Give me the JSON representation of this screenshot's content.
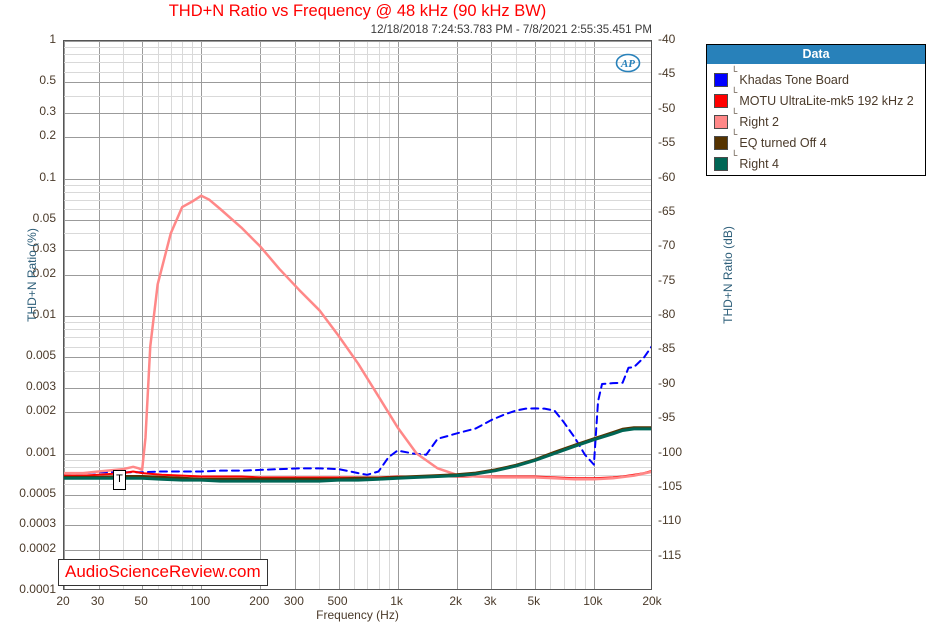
{
  "chart_data": {
    "type": "line",
    "title": "THD+N Ratio vs Frequency @ 48 kHz (90 kHz BW)",
    "subtitle": "12/18/2018 7:24:53.783 PM - 7/8/2021 2:55:35.451 PM",
    "xlabel": "Frequency (Hz)",
    "ylabel": "THD+N Ratio (%)",
    "ylabel_right": "THD+N Ratio (dB)",
    "xscale": "log",
    "yscale": "log",
    "xlim": [
      20,
      20000
    ],
    "ylim": [
      0.0001,
      1
    ],
    "ylim_right": [
      -120,
      -40
    ],
    "grid": true,
    "legend_position": "outside-right",
    "legend_title": "Data",
    "xticks": [
      "20",
      "30",
      "50",
      "100",
      "200",
      "300",
      "500",
      "1k",
      "2k",
      "3k",
      "5k",
      "10k",
      "20k"
    ],
    "xtick_values": [
      20,
      30,
      50,
      100,
      200,
      300,
      500,
      1000,
      2000,
      3000,
      5000,
      10000,
      20000
    ],
    "yticks": [
      "1",
      "0.5",
      "0.3",
      "0.2",
      "0.1",
      "0.05",
      "0.03",
      "0.02",
      "0.01",
      "0.005",
      "0.003",
      "0.002",
      "0.001",
      "0.0005",
      "0.0003",
      "0.0002",
      "0.0001"
    ],
    "ytick_values": [
      1,
      0.5,
      0.3,
      0.2,
      0.1,
      0.05,
      0.03,
      0.02,
      0.01,
      0.005,
      0.003,
      0.002,
      0.001,
      0.0005,
      0.0003,
      0.0002,
      0.0001
    ],
    "yticks_right": [
      "-40",
      "-45",
      "-50",
      "-55",
      "-60",
      "-65",
      "-70",
      "-75",
      "-80",
      "-85",
      "-90",
      "-95",
      "-100",
      "-105",
      "-110",
      "-115"
    ],
    "ytick_right_values": [
      -40,
      -45,
      -50,
      -55,
      -60,
      -65,
      -70,
      -75,
      -80,
      -85,
      -90,
      -95,
      -100,
      -105,
      -110,
      -115
    ],
    "annotation_watermark": "AudioScienceReview.com",
    "cursor_marker": {
      "label": "T",
      "x": 45,
      "y": 0.00072
    },
    "series": [
      {
        "name": "Khadas Tone Board",
        "color": "#0000ff",
        "style": "dashed",
        "width": 2,
        "points": [
          [
            20,
            0.00072
          ],
          [
            25,
            0.00072
          ],
          [
            30,
            0.00073
          ],
          [
            40,
            0.00073
          ],
          [
            50,
            0.00073
          ],
          [
            63,
            0.00074
          ],
          [
            80,
            0.00074
          ],
          [
            100,
            0.00074
          ],
          [
            125,
            0.00075
          ],
          [
            160,
            0.00075
          ],
          [
            200,
            0.00076
          ],
          [
            250,
            0.00077
          ],
          [
            315,
            0.00078
          ],
          [
            400,
            0.00078
          ],
          [
            500,
            0.00077
          ],
          [
            630,
            0.00072
          ],
          [
            700,
            0.0007
          ],
          [
            800,
            0.00074
          ],
          [
            900,
            0.00094
          ],
          [
            1000,
            0.00105
          ],
          [
            1200,
            0.001
          ],
          [
            1400,
            0.00098
          ],
          [
            1600,
            0.00128
          ],
          [
            1800,
            0.00134
          ],
          [
            2000,
            0.0014
          ],
          [
            2500,
            0.00152
          ],
          [
            3000,
            0.00175
          ],
          [
            3500,
            0.00192
          ],
          [
            4000,
            0.00205
          ],
          [
            4500,
            0.00212
          ],
          [
            5000,
            0.00213
          ],
          [
            5600,
            0.00212
          ],
          [
            6300,
            0.00205
          ],
          [
            7000,
            0.0017
          ],
          [
            8000,
            0.0013
          ],
          [
            9000,
            0.00098
          ],
          [
            10000,
            0.00083
          ],
          [
            10500,
            0.0024
          ],
          [
            11000,
            0.0032
          ],
          [
            12500,
            0.00325
          ],
          [
            14000,
            0.00327
          ],
          [
            15000,
            0.0042
          ],
          [
            16000,
            0.00425
          ],
          [
            18000,
            0.005
          ],
          [
            20000,
            0.0062
          ]
        ]
      },
      {
        "name": "MOTU UltraLite-mk5  192 kHz  2",
        "color": "#ff0000",
        "style": "solid",
        "width": 2,
        "points": [
          [
            20,
            0.00069
          ],
          [
            25,
            0.00069
          ],
          [
            30,
            0.0007
          ],
          [
            40,
            0.00072
          ],
          [
            45,
            0.00074
          ],
          [
            50,
            0.00072
          ],
          [
            63,
            0.0007
          ],
          [
            80,
            0.00069
          ],
          [
            100,
            0.00068
          ],
          [
            125,
            0.00068
          ],
          [
            160,
            0.00068
          ],
          [
            200,
            0.00067
          ],
          [
            250,
            0.00067
          ],
          [
            315,
            0.00067
          ],
          [
            400,
            0.00067
          ],
          [
            500,
            0.00067
          ],
          [
            630,
            0.00067
          ],
          [
            800,
            0.00067
          ],
          [
            1000,
            0.00068
          ],
          [
            1250,
            0.00068
          ],
          [
            1600,
            0.00068
          ],
          [
            2000,
            0.00068
          ],
          [
            2500,
            0.00068
          ],
          [
            3150,
            0.00068
          ],
          [
            4000,
            0.00068
          ],
          [
            5000,
            0.00068
          ],
          [
            6300,
            0.00067
          ],
          [
            8000,
            0.00066
          ],
          [
            10000,
            0.00066
          ],
          [
            12500,
            0.00067
          ],
          [
            14000,
            0.00068
          ],
          [
            16000,
            0.0007
          ],
          [
            18000,
            0.00072
          ],
          [
            20000,
            0.00075
          ]
        ]
      },
      {
        "name": "Right 2",
        "color": "#ff8888",
        "style": "solid",
        "width": 2.5,
        "points": [
          [
            20,
            0.00072
          ],
          [
            25,
            0.00072
          ],
          [
            30,
            0.00074
          ],
          [
            40,
            0.00077
          ],
          [
            45,
            0.0008
          ],
          [
            48,
            0.00078
          ],
          [
            50,
            0.00076
          ],
          [
            52,
            0.0013
          ],
          [
            55,
            0.006
          ],
          [
            60,
            0.017
          ],
          [
            70,
            0.04
          ],
          [
            80,
            0.062
          ],
          [
            90,
            0.068
          ],
          [
            100,
            0.075
          ],
          [
            110,
            0.07
          ],
          [
            125,
            0.06
          ],
          [
            160,
            0.044
          ],
          [
            200,
            0.032
          ],
          [
            250,
            0.022
          ],
          [
            315,
            0.0155
          ],
          [
            400,
            0.011
          ],
          [
            500,
            0.0072
          ],
          [
            630,
            0.0045
          ],
          [
            800,
            0.0026
          ],
          [
            1000,
            0.00155
          ],
          [
            1250,
            0.001
          ],
          [
            1600,
            0.00078
          ],
          [
            2000,
            0.0007
          ],
          [
            2500,
            0.00068
          ],
          [
            3150,
            0.00067
          ],
          [
            4000,
            0.00067
          ],
          [
            5000,
            0.00067
          ],
          [
            6300,
            0.00066
          ],
          [
            8000,
            0.00065
          ],
          [
            10000,
            0.00065
          ],
          [
            12500,
            0.00066
          ],
          [
            16000,
            0.00069
          ],
          [
            20000,
            0.00074
          ]
        ]
      },
      {
        "name": "EQ turned Off  4",
        "color": "#553300",
        "style": "solid",
        "width": 3,
        "points": [
          [
            20,
            0.00067
          ],
          [
            25,
            0.00067
          ],
          [
            30,
            0.00067
          ],
          [
            40,
            0.00068
          ],
          [
            50,
            0.00068
          ],
          [
            63,
            0.00067
          ],
          [
            80,
            0.00066
          ],
          [
            100,
            0.00065
          ],
          [
            125,
            0.00065
          ],
          [
            160,
            0.00065
          ],
          [
            200,
            0.00065
          ],
          [
            250,
            0.00065
          ],
          [
            315,
            0.00065
          ],
          [
            400,
            0.00065
          ],
          [
            500,
            0.00065
          ],
          [
            630,
            0.00066
          ],
          [
            800,
            0.00066
          ],
          [
            1000,
            0.00067
          ],
          [
            1250,
            0.00068
          ],
          [
            1600,
            0.00069
          ],
          [
            2000,
            0.0007
          ],
          [
            2500,
            0.00072
          ],
          [
            3150,
            0.00076
          ],
          [
            4000,
            0.00082
          ],
          [
            5000,
            0.0009
          ],
          [
            6300,
            0.00102
          ],
          [
            8000,
            0.00115
          ],
          [
            10000,
            0.00128
          ],
          [
            12500,
            0.00142
          ],
          [
            14000,
            0.0015
          ],
          [
            16000,
            0.00154
          ],
          [
            18000,
            0.00154
          ],
          [
            20000,
            0.00154
          ]
        ]
      },
      {
        "name": "Right 4",
        "color": "#006655",
        "style": "solid",
        "width": 3,
        "points": [
          [
            20,
            0.00066
          ],
          [
            25,
            0.00066
          ],
          [
            30,
            0.00066
          ],
          [
            40,
            0.00066
          ],
          [
            50,
            0.00066
          ],
          [
            63,
            0.00065
          ],
          [
            80,
            0.00064
          ],
          [
            100,
            0.00064
          ],
          [
            125,
            0.00063
          ],
          [
            160,
            0.00063
          ],
          [
            200,
            0.00063
          ],
          [
            250,
            0.00063
          ],
          [
            315,
            0.00063
          ],
          [
            400,
            0.00063
          ],
          [
            500,
            0.00064
          ],
          [
            630,
            0.00064
          ],
          [
            800,
            0.00065
          ],
          [
            1000,
            0.00066
          ],
          [
            1250,
            0.00067
          ],
          [
            1600,
            0.00068
          ],
          [
            2000,
            0.00069
          ],
          [
            2500,
            0.00071
          ],
          [
            3150,
            0.00075
          ],
          [
            4000,
            0.00081
          ],
          [
            5000,
            0.00089
          ],
          [
            6300,
            0.001
          ],
          [
            8000,
            0.00113
          ],
          [
            10000,
            0.00126
          ],
          [
            12500,
            0.00139
          ],
          [
            14000,
            0.00147
          ],
          [
            16000,
            0.00151
          ],
          [
            18000,
            0.00151
          ],
          [
            20000,
            0.00151
          ]
        ]
      }
    ]
  },
  "legend": {
    "title": "Data",
    "header_color": "#2881ba",
    "sub_glyph": "└",
    "items": [
      {
        "label": "Khadas Tone Board",
        "color": "#0000ff"
      },
      {
        "label": "MOTU UltraLite-mk5  192 kHz  2",
        "color": "#ff0000"
      },
      {
        "label": "Right 2",
        "color": "#ff8888"
      },
      {
        "label": "EQ turned Off  4",
        "color": "#553300"
      },
      {
        "label": "Right 4",
        "color": "#006655"
      }
    ]
  },
  "watermark": {
    "text": "AudioScienceReview.com",
    "color": "#ff0000"
  },
  "cursor": {
    "label": "T"
  },
  "logo": {
    "text": "AP"
  }
}
